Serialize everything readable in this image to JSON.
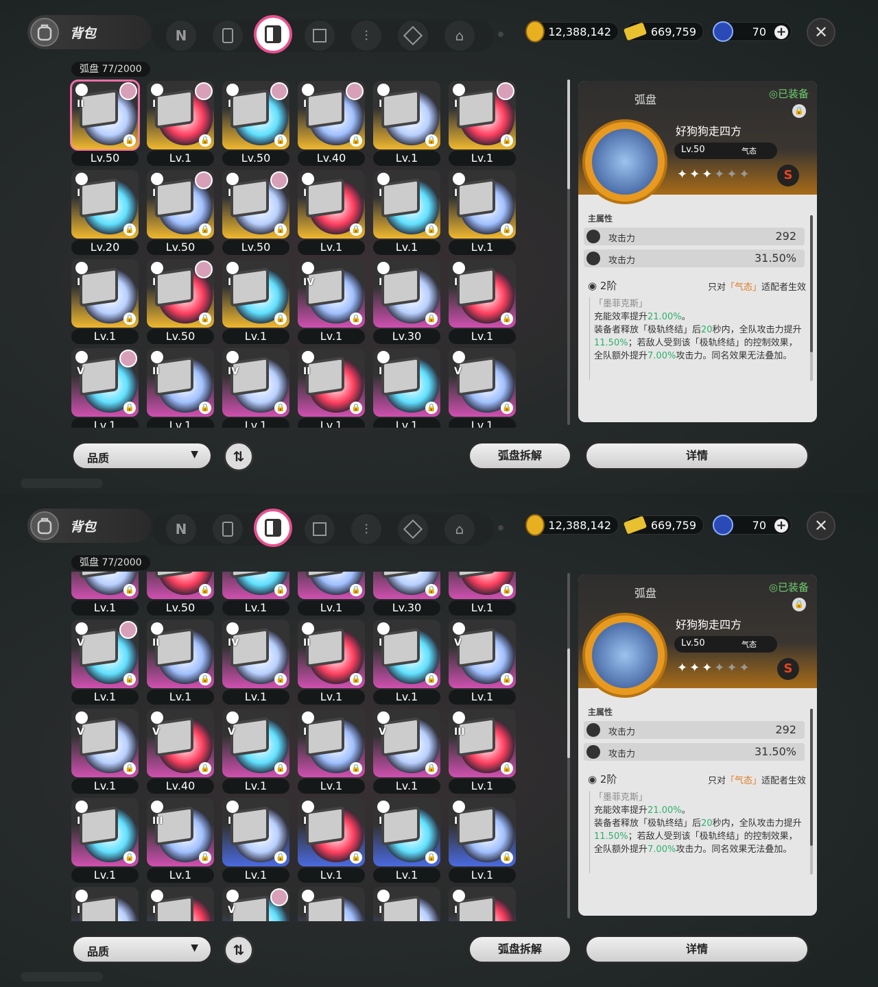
{
  "header": {
    "title": "背包",
    "close_label": "✕"
  },
  "tabs": [
    {
      "icon": "n-logo-icon"
    },
    {
      "icon": "gameboy-icon"
    },
    {
      "icon": "disc-drive-icon",
      "active": true
    },
    {
      "icon": "cube-icon"
    },
    {
      "icon": "utensils-icon"
    },
    {
      "icon": "cube-box-icon"
    },
    {
      "icon": "home-icon"
    }
  ],
  "currency": {
    "coins": "12,388,142",
    "tickets": "669,759",
    "energy": "70"
  },
  "count_label": "弧盘 77/2000",
  "colors": {
    "gold": "#f0a020",
    "purple": "#b0409a",
    "red": "#e0304a",
    "blue": "#3a5ad0",
    "accent": "#e8508e"
  },
  "screens": [
    {
      "rows": [
        [
          {
            "lv": "Lv.50",
            "rank": "II",
            "tier": "gold",
            "face": true,
            "sel": true
          },
          {
            "lv": "Lv.1",
            "rank": "I",
            "tier": "gold",
            "face": true
          },
          {
            "lv": "Lv.50",
            "rank": "I",
            "tier": "gold",
            "face": true
          },
          {
            "lv": "Lv.40",
            "rank": "I",
            "tier": "gold",
            "face": true
          },
          {
            "lv": "Lv.1",
            "rank": "I",
            "tier": "gold"
          },
          {
            "lv": "Lv.1",
            "rank": "I",
            "tier": "gold",
            "face": true
          }
        ],
        [
          {
            "lv": "Lv.20",
            "rank": "I",
            "tier": "gold"
          },
          {
            "lv": "Lv.50",
            "rank": "I",
            "tier": "gold",
            "face": true
          },
          {
            "lv": "Lv.50",
            "rank": "I",
            "tier": "gold",
            "face": true
          },
          {
            "lv": "Lv.1",
            "rank": "I",
            "tier": "gold"
          },
          {
            "lv": "Lv.1",
            "rank": "I",
            "tier": "gold"
          },
          {
            "lv": "Lv.1",
            "rank": "I",
            "tier": "gold"
          }
        ],
        [
          {
            "lv": "Lv.1",
            "rank": "I",
            "tier": "gold"
          },
          {
            "lv": "Lv.50",
            "rank": "I",
            "tier": "gold",
            "face": true
          },
          {
            "lv": "Lv.1",
            "rank": "I",
            "tier": "gold"
          },
          {
            "lv": "Lv.1",
            "rank": "IV",
            "tier": "purple"
          },
          {
            "lv": "Lv.30",
            "rank": "I",
            "tier": "purple"
          },
          {
            "lv": "Lv.1",
            "rank": "I",
            "tier": "purple"
          }
        ],
        [
          {
            "lv": "Lv.1",
            "rank": "V",
            "tier": "purple",
            "face": true
          },
          {
            "lv": "Lv.1",
            "rank": "II",
            "tier": "purple"
          },
          {
            "lv": "Lv.1",
            "rank": "IV",
            "tier": "purple"
          },
          {
            "lv": "Lv.1",
            "rank": "II",
            "tier": "purple"
          },
          {
            "lv": "Lv.1",
            "rank": "I",
            "tier": "purple"
          },
          {
            "lv": "Lv.1",
            "rank": "V",
            "tier": "purple"
          }
        ]
      ]
    },
    {
      "rows": [
        [
          {
            "lv": "Lv.1",
            "rank": "",
            "tier": "purple"
          },
          {
            "lv": "Lv.50",
            "rank": "",
            "tier": "purple"
          },
          {
            "lv": "Lv.1",
            "rank": "",
            "tier": "purple"
          },
          {
            "lv": "Lv.1",
            "rank": "",
            "tier": "purple"
          },
          {
            "lv": "Lv.30",
            "rank": "",
            "tier": "purple"
          },
          {
            "lv": "Lv.1",
            "rank": "",
            "tier": "purple"
          }
        ],
        [
          {
            "lv": "Lv.1",
            "rank": "V",
            "tier": "purple",
            "face": true
          },
          {
            "lv": "Lv.1",
            "rank": "II",
            "tier": "purple"
          },
          {
            "lv": "Lv.1",
            "rank": "IV",
            "tier": "purple"
          },
          {
            "lv": "Lv.1",
            "rank": "II",
            "tier": "purple"
          },
          {
            "lv": "Lv.1",
            "rank": "I",
            "tier": "purple"
          },
          {
            "lv": "Lv.1",
            "rank": "V",
            "tier": "purple"
          }
        ],
        [
          {
            "lv": "Lv.1",
            "rank": "V",
            "tier": "purple"
          },
          {
            "lv": "Lv.40",
            "rank": "V",
            "tier": "purple"
          },
          {
            "lv": "Lv.1",
            "rank": "V",
            "tier": "purple"
          },
          {
            "lv": "Lv.1",
            "rank": "I",
            "tier": "purple"
          },
          {
            "lv": "Lv.1",
            "rank": "V",
            "tier": "purple"
          },
          {
            "lv": "Lv.1",
            "rank": "III",
            "tier": "purple"
          }
        ],
        [
          {
            "lv": "Lv.1",
            "rank": "I",
            "tier": "purple"
          },
          {
            "lv": "Lv.1",
            "rank": "III",
            "tier": "purple"
          },
          {
            "lv": "Lv.1",
            "rank": "I",
            "tier": "blue"
          },
          {
            "lv": "Lv.1",
            "rank": "I",
            "tier": "blue"
          },
          {
            "lv": "Lv.1",
            "rank": "I",
            "tier": "blue"
          },
          {
            "lv": "Lv.1",
            "rank": "I",
            "tier": "blue"
          }
        ],
        [
          {
            "lv": "",
            "rank": "I",
            "tier": "blue"
          },
          {
            "lv": "",
            "rank": "I",
            "tier": "blue"
          },
          {
            "lv": "",
            "rank": "V",
            "tier": "blue",
            "face": true
          },
          {
            "lv": "",
            "rank": "I",
            "tier": "blue"
          },
          {
            "lv": "",
            "rank": "I",
            "tier": "blue"
          },
          {
            "lv": "",
            "rank": "I",
            "tier": "blue"
          }
        ]
      ]
    }
  ],
  "detail": {
    "type": "弧盘",
    "equipped": "◎已装备",
    "name": "好狗狗走四方",
    "level": "Lv.50",
    "attribute": "气态",
    "stars_on": 3,
    "stars_total": 6,
    "grade": "S",
    "main_attr_label": "主属性",
    "stats": [
      {
        "name": "攻击力",
        "value": "292"
      },
      {
        "name": "攻击力",
        "value": "31.50%"
      }
    ],
    "tier": "2阶",
    "tier_req_pre": "只对",
    "tier_req_attr": "「气态」",
    "tier_req_post": "适配者生效",
    "desc_title": "「墨菲克斯」",
    "desc_line1_pre": "充能效率提升",
    "desc_line1_val": "21.00%",
    "desc_line1_post": "。",
    "desc_p2_a": "装备者释放「极轨终结」后",
    "desc_p2_b": "20",
    "desc_p2_c": "秒内，全队攻击力提升",
    "desc_p2_d": "11.50%",
    "desc_p2_e": "；若敌人受到该「极轨终结」的控制效果，全队额外提升",
    "desc_p2_f": "7.00%",
    "desc_p2_g": "攻击力。同名效果无法叠加。"
  },
  "bottom": {
    "filter_label": "品质",
    "dismantle_label": "弧盘拆解",
    "details_label": "详情",
    "sort_icon": "sort-icon"
  }
}
